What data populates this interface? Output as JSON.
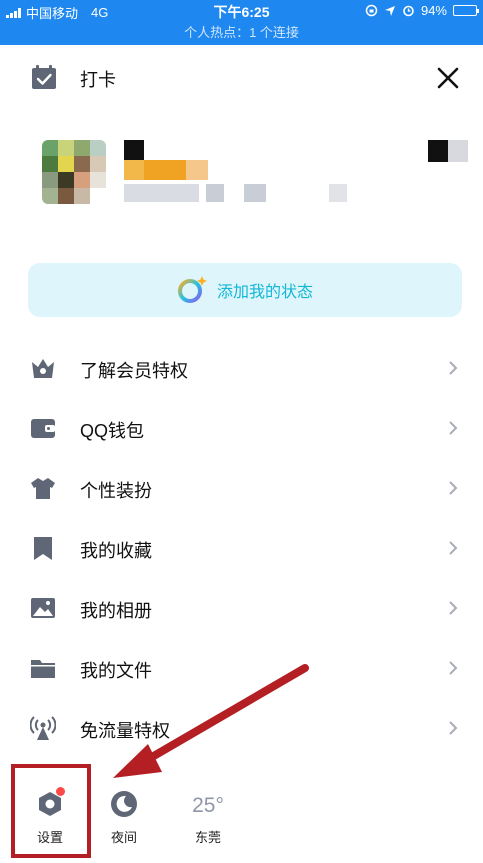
{
  "status_bar": {
    "carrier": "中国移动",
    "network": "4G",
    "time": "下午6:25",
    "battery": "94%",
    "battery_level": 0.94,
    "hotspot": "个人热点：1 个连接",
    "colors": {
      "background": "#1e88f0"
    }
  },
  "header": {
    "checkin_label": "打卡",
    "checkin_icon": "calendar-check-icon",
    "close_icon": "close-icon"
  },
  "status_button": {
    "label": "添加我的状态",
    "icon": "status-ring-icon"
  },
  "menu": [
    {
      "label": "了解会员特权",
      "icon": "crown-icon"
    },
    {
      "label": "QQ钱包",
      "icon": "wallet-icon"
    },
    {
      "label": "个性装扮",
      "icon": "shirt-icon"
    },
    {
      "label": "我的收藏",
      "icon": "bookmark-icon"
    },
    {
      "label": "我的相册",
      "icon": "photo-icon"
    },
    {
      "label": "我的文件",
      "icon": "folder-icon"
    },
    {
      "label": "免流量特权",
      "icon": "signal-tower-icon"
    }
  ],
  "bottom_bar": {
    "settings": {
      "label": "设置",
      "icon": "settings-hexagon-icon"
    },
    "night": {
      "label": "夜间",
      "icon": "moon-icon"
    },
    "weather": {
      "temp": "25°",
      "city": "东莞"
    }
  },
  "colors": {
    "accent": "#1e88f0",
    "icon_gray": "#5f6676",
    "status_text": "#12b7d6",
    "status_bg": "#def5fb",
    "annotation_red": "#b41f24",
    "badge": "#ff4a4a"
  }
}
